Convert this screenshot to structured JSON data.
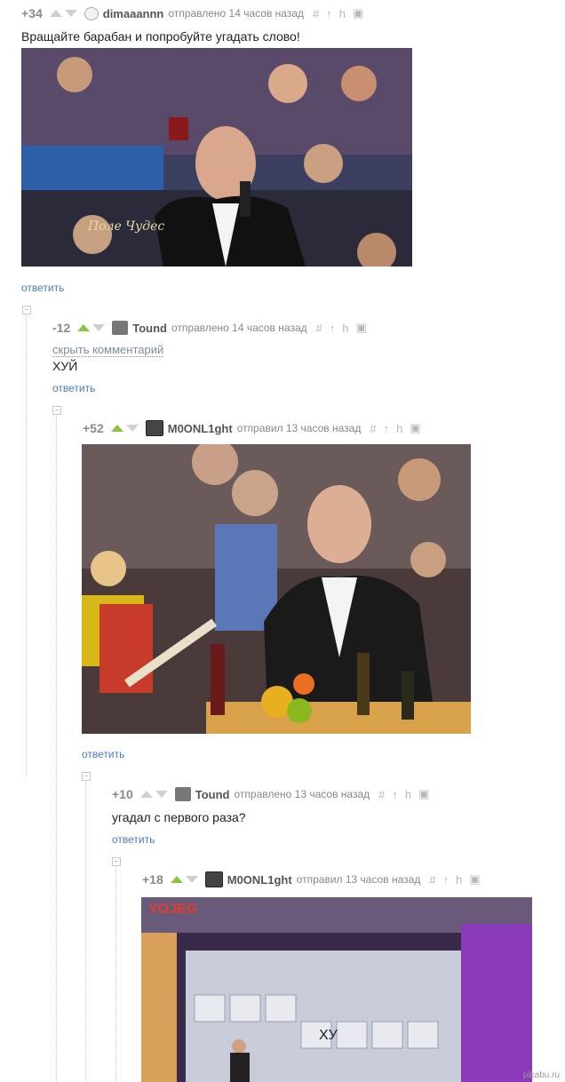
{
  "comments": [
    {
      "rating": "+34",
      "user": "dimaaannn",
      "meta": "отправлено 14 часов назад",
      "text": "Вращайте барабан и попробуйте угадать слово!",
      "reply": "ответить"
    },
    {
      "rating": "-12",
      "user": "Tound",
      "meta": "отправлено 14 часов назад",
      "hide": "скрыть комментарий",
      "text": "ХУЙ",
      "reply": "ответить"
    },
    {
      "rating": "+52",
      "user": "M0ONL1ght",
      "meta": "отправил 13 часов назад",
      "reply": "ответить"
    },
    {
      "rating": "+10",
      "user": "Tound",
      "meta": "отправлено 13 часов назад",
      "text": "угадал с первого раза?",
      "reply": "ответить"
    },
    {
      "rating": "+18",
      "user": "M0ONL1ght",
      "meta": "отправил 13 часов назад"
    }
  ],
  "images": {
    "logo_text": "Поле Чудес",
    "board_title": "YOJEG",
    "board_letters": "ХУ"
  },
  "tools": [
    "#",
    "↑",
    "h",
    "▣"
  ],
  "collapse_glyph": "−",
  "watermark": "pikabu.ru",
  "colors": {
    "green": "#8cc63f",
    "link": "#4a7cc0",
    "grey": "#cfcfcf"
  }
}
